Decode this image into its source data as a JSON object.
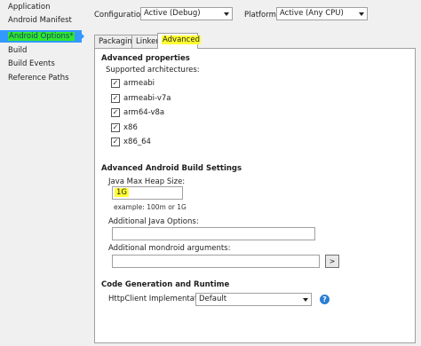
{
  "sidebar": {
    "items": [
      {
        "label": "Application"
      },
      {
        "label": "Android Manifest"
      },
      {
        "label": "Android Options*"
      },
      {
        "label": "Build"
      },
      {
        "label": "Build Events"
      },
      {
        "label": "Reference Paths"
      }
    ],
    "active_index": 2
  },
  "toolbar": {
    "configuration_label": "Configuration:",
    "configuration_value": "Active (Debug)",
    "platform_label": "Platform:",
    "platform_value": "Active (Any CPU)"
  },
  "tabs": [
    {
      "label": "Packaging"
    },
    {
      "label": "Linker"
    },
    {
      "label": "Advanced"
    }
  ],
  "active_tab": "Advanced",
  "advanced": {
    "properties_heading": "Advanced properties",
    "supported_arch_label": "Supported architectures:",
    "architectures": [
      {
        "label": "armeabi",
        "checked": true,
        "mark": "✓"
      },
      {
        "label": "armeabi-v7a",
        "checked": true,
        "mark": "✓"
      },
      {
        "label": "arm64-v8a",
        "checked": true,
        "mark": "✓"
      },
      {
        "label": "x86",
        "checked": true,
        "mark": "✓"
      },
      {
        "label": "x86_64",
        "checked": true,
        "mark": "✓"
      }
    ],
    "build_heading": "Advanced Android Build Settings",
    "heap_label": "Java Max Heap Size:",
    "heap_value": "1G",
    "heap_example": "example: 100m or 1G",
    "java_options_label": "Additional Java Options:",
    "java_options_value": "",
    "mondroid_label": "Additional mondroid arguments:",
    "mondroid_value": "",
    "mondroid_button": ">",
    "codegen_heading": "Code Generation and Runtime",
    "httpclient_label": "HttpClient Implementation",
    "httpclient_value": "Default",
    "help_glyph": "?"
  },
  "colors": {
    "selection": "#3399ff",
    "green_highlight": "#2ee82e",
    "yellow_highlight": "#ffff33",
    "help_icon": "#2a7fd4"
  }
}
